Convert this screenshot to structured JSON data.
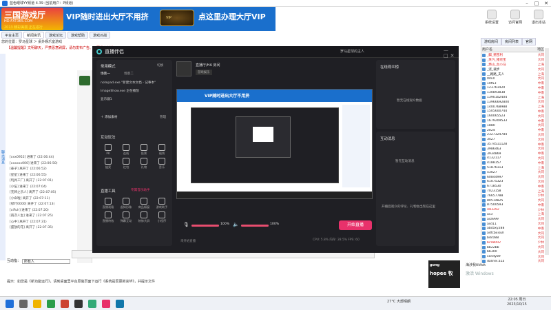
{
  "window": {
    "title": "蓝色眼球YY频道 4.39 (当前用户：P频道)"
  },
  "banner": {
    "logo_main": "三国游戏厅",
    "logo_url": "HD.FXT365.COM",
    "logo_slogan": "2013 精彩美丽 正在进行",
    "text_left": "VIP随时进出大厅不用挤",
    "badge": "VIP",
    "text_right": "点这里办理大厅VIP"
  },
  "right_tools": [
    "系统设置",
    "访问官网",
    "退出本站"
  ],
  "nav": {
    "tabs": [
      "平台主页",
      "新闻资讯",
      "游戏论坛",
      "游戏帮助",
      "游戏对战"
    ]
  },
  "path": {
    "text": "您的位置：罗马星球 ＞ 桌外娱乐室游戏",
    "notice": "【温馨提醒】文明聊天，严禁恶意刷屏，请勿发布广告、不要发布外挂"
  },
  "left_side_label": "聊天消息",
  "chat_log": [
    "[xxx0952] 进来了 (22:06:44)",
    "[xxxxxx000] 进来了 (22:06:50)",
    "[姜子] 离开了 (22:06:52)",
    "[星星] 进来了 (22:06:55)",
    "[玩具工厂] 离开了 (22:07:01)",
    "[小伍] 进来了 (22:07:04)",
    "[无牌之乐人] 离开了 (22:07:05)",
    "[小命啦] 离开了 (22:07:11)",
    "[绿叶0000] 离开了 (22:07:13)",
    "[xiFuh] 进来了 (22:07:20)",
    "[再次人生] 进来了 (22:07:25)",
    "[心中] 离开了 (22:07:31)",
    "[盛放的花] 离开了 (22:07:35)"
  ],
  "input_bar": {
    "label": "互动指：",
    "value": "所有人"
  },
  "hint": "提示：如您是《新功能运行》，请到桌面里平台原装页面下运行《系统是否更新完毕》，并提示文件",
  "obs": {
    "title": "直播伴侣",
    "user": "罗马星球的主人",
    "scene_header": "常用模式",
    "scene_btn": "切换",
    "scene_tabs": [
      "场景一",
      "场景二"
    ],
    "sources": [
      "notepad.exe \"新建文本文档 - 记事本\"",
      "ImageShow.exe 正在播放",
      "显示器1"
    ],
    "add_source": "＋ 添加素材",
    "manage": "管理",
    "interact_header": "互动玩法",
    "interact_tools": [
      "PK",
      "连线",
      "投票",
      "福袋",
      "抽奖",
      "红包",
      "礼物",
      "音乐"
    ],
    "live_tools_header": "直播工具",
    "live_tools_tip": "专属音乐助手",
    "live_tools": [
      "直播观看",
      "虚拟形象",
      "商品橱窗",
      "游戏助手",
      "直播特效",
      "弹幕互动",
      "装修大屏",
      "小程序"
    ],
    "room_name": "直播厅/HA 房间",
    "room_tag": "游戏娱乐",
    "quality": [
      "标清",
      "超清"
    ],
    "mic_vol": "100%",
    "spk_vol": "100%",
    "go_live": "开始直播",
    "status": "未开始直播",
    "stats": "CPU: 5.8%    内存: 28.5%    FPS: 60",
    "right_header1": "在线观众榜",
    "right_empty1": "暂无在线观众数据",
    "right_header2": "互动消息",
    "right_empty2": "开播后观众的评论、礼物会出现在这里",
    "right_hint2": "暂无互动消息"
  },
  "right_panel": {
    "tabs": [
      "游戏房间",
      "房间列表",
      "官网"
    ],
    "head": [
      "用户名",
      "地区"
    ],
    "users": [
      {
        "name": "_麒_猪宝利",
        "loc": "大同",
        "red": true
      },
      {
        "name": "_蒸汽_猪兜宝",
        "loc": "大同",
        "red": true
      },
      {
        "name": "_燃山_台小马",
        "loc": "上海",
        "red": true
      },
      {
        "name": "_泥_裁步",
        "loc": "大同",
        "red": false
      },
      {
        "name": "__路路_夫人",
        "loc": "上海",
        "red": false
      },
      {
        "name": "0mill",
        "loc": "大同",
        "red": false
      },
      {
        "name": "10t53",
        "loc": "中南",
        "red": false
      },
      {
        "name": "123761420",
        "loc": "中南",
        "red": false
      },
      {
        "name": "130893838",
        "loc": "中南",
        "red": false
      },
      {
        "name": "1390102404",
        "loc": "上海",
        "red": false
      },
      {
        "name": "13966692800",
        "loc": "大同",
        "red": false
      },
      {
        "name": "1400768988",
        "loc": "上海",
        "red": false
      },
      {
        "name": "1505600744",
        "loc": "中南",
        "red": false
      },
      {
        "name": "160065523",
        "loc": "大同",
        "red": false
      },
      {
        "name": "1679209533",
        "loc": "中南",
        "red": false
      },
      {
        "name": "1880",
        "loc": "大同",
        "red": false
      },
      {
        "name": "2024",
        "loc": "中南",
        "red": false
      },
      {
        "name": "2327324784",
        "loc": "大同",
        "red": false
      },
      {
        "name": "3427",
        "loc": "大同",
        "red": false
      },
      {
        "name": "3574511128",
        "loc": "中南",
        "red": false
      },
      {
        "name": "3986463",
        "loc": "大同",
        "red": false
      },
      {
        "name": "3934869",
        "loc": "中南",
        "red": false
      },
      {
        "name": "4132117",
        "loc": "大同",
        "red": false
      },
      {
        "name": "4188157",
        "loc": "中南",
        "red": false
      },
      {
        "name": "51876113",
        "loc": "上海",
        "red": false
      },
      {
        "name": "53027",
        "loc": "大同",
        "red": false
      },
      {
        "name": "60844997",
        "loc": "大同",
        "red": false
      },
      {
        "name": "61075323",
        "loc": "大同",
        "red": false
      },
      {
        "name": "6718530",
        "loc": "中南",
        "red": false
      },
      {
        "name": "7023158",
        "loc": "上海",
        "red": false
      },
      {
        "name": "76657788",
        "loc": "少林",
        "red": false
      },
      {
        "name": "80514825",
        "loc": "大同",
        "red": false
      },
      {
        "name": "87500593",
        "loc": "中南",
        "red": false
      },
      {
        "name": "A83292",
        "loc": "少林",
        "red": true
      },
      {
        "name": "as3",
        "loc": "上海",
        "red": false
      },
      {
        "name": "asa999",
        "loc": "大同",
        "red": false
      },
      {
        "name": "asd11",
        "loc": "大同",
        "red": false
      },
      {
        "name": "abcbxy288",
        "loc": "中南",
        "red": false
      },
      {
        "name": "adfcbxisuh",
        "loc": "大同",
        "red": false
      },
      {
        "name": "bdc088",
        "loc": "大同",
        "red": false
      },
      {
        "name": "bc98002",
        "loc": "少林",
        "red": true
      },
      {
        "name": "bb22bb",
        "loc": "大同",
        "red": false
      },
      {
        "name": "bb300",
        "loc": "大同",
        "red": false
      },
      {
        "name": "candy89",
        "loc": "大同",
        "red": false
      },
      {
        "name": "dalinei.a1a",
        "loc": "大同",
        "red": false
      }
    ]
  },
  "overlay": {
    "shopee": "hopee 牧",
    "brand_top": "gong",
    "sub": "海涉我tiktok",
    "activate": "激活 Windows"
  },
  "taskbar": {
    "weather": "27°C  大部晴朗",
    "time": "22:05  周日",
    "date": "2023/10/15"
  }
}
